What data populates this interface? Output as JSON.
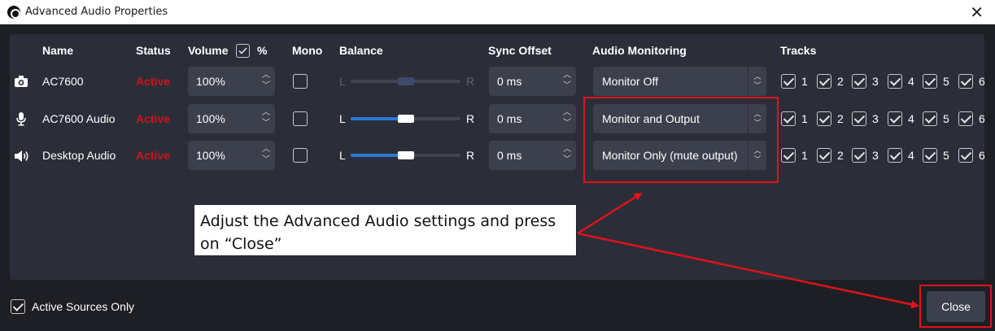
{
  "window": {
    "title": "Advanced Audio Properties",
    "close_glyph": "✕"
  },
  "headers": {
    "name": "Name",
    "status": "Status",
    "volume": "Volume",
    "volume_unit": "%",
    "volume_percent_checked": true,
    "mono": "Mono",
    "balance": "Balance",
    "sync_offset": "Sync Offset",
    "audio_monitoring": "Audio Monitoring",
    "tracks": "Tracks"
  },
  "sources": [
    {
      "icon": "camera-icon",
      "name": "AC7600",
      "status": "Active",
      "volume": "100%",
      "mono": false,
      "balance": {
        "left": "L",
        "right": "R",
        "value": 0.5,
        "enabled": false
      },
      "sync_offset": "0 ms",
      "monitoring": "Monitor Off",
      "tracks": [
        {
          "n": "1",
          "checked": true
        },
        {
          "n": "2",
          "checked": true
        },
        {
          "n": "3",
          "checked": true
        },
        {
          "n": "4",
          "checked": true
        },
        {
          "n": "5",
          "checked": true
        },
        {
          "n": "6",
          "checked": true
        }
      ]
    },
    {
      "icon": "microphone-icon",
      "name": "AC7600 Audio",
      "status": "Active",
      "volume": "100%",
      "mono": false,
      "balance": {
        "left": "L",
        "right": "R",
        "value": 0.5,
        "enabled": true
      },
      "sync_offset": "0 ms",
      "monitoring": "Monitor and Output",
      "tracks": [
        {
          "n": "1",
          "checked": true
        },
        {
          "n": "2",
          "checked": true
        },
        {
          "n": "3",
          "checked": true
        },
        {
          "n": "4",
          "checked": true
        },
        {
          "n": "5",
          "checked": true
        },
        {
          "n": "6",
          "checked": true
        }
      ]
    },
    {
      "icon": "speaker-icon",
      "name": "Desktop Audio",
      "status": "Active",
      "volume": "100%",
      "mono": false,
      "balance": {
        "left": "L",
        "right": "R",
        "value": 0.5,
        "enabled": true
      },
      "sync_offset": "0 ms",
      "monitoring": "Monitor Only (mute output)",
      "tracks": [
        {
          "n": "1",
          "checked": true
        },
        {
          "n": "2",
          "checked": true
        },
        {
          "n": "3",
          "checked": true
        },
        {
          "n": "4",
          "checked": true
        },
        {
          "n": "5",
          "checked": true
        },
        {
          "n": "6",
          "checked": true
        }
      ]
    }
  ],
  "annotation": {
    "text_line1": "Adjust the Advanced Audio settings and press",
    "text_line2": "on “Close”"
  },
  "footer": {
    "active_sources_only_label": "Active Sources Only",
    "active_sources_only_checked": true,
    "close_label": "Close"
  },
  "colors": {
    "background": "#1e1f24",
    "panel": "#2b2e38",
    "control": "#3c404d",
    "status_active": "#d0131a",
    "slider_fill": "#2a78d6",
    "annotation_red": "#e0131b"
  }
}
